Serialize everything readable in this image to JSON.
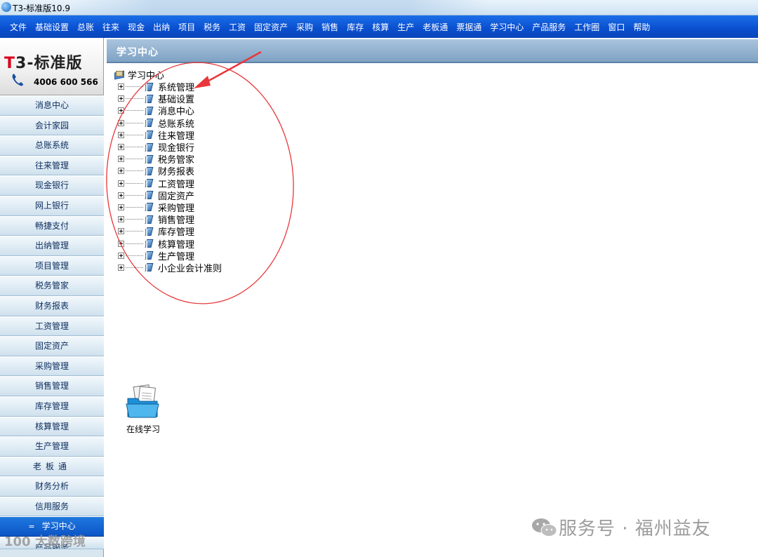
{
  "window": {
    "title": "T3-标准版10.9"
  },
  "menu": [
    "文件",
    "基础设置",
    "总账",
    "往来",
    "现金",
    "出纳",
    "项目",
    "税务",
    "工资",
    "固定资产",
    "采购",
    "销售",
    "库存",
    "核算",
    "生产",
    "老板通",
    "票据通",
    "学习中心",
    "产品服务",
    "工作圈",
    "窗口",
    "帮助"
  ],
  "logo": {
    "brand": "-标准版",
    "brand_letter_t": "T",
    "brand_num": "3",
    "phone": "4006 600 566"
  },
  "sidebar": {
    "items": [
      "消息中心",
      "会计家园",
      "总账系统",
      "往来管理",
      "现金银行",
      "网上银行",
      "畅捷支付",
      "出纳管理",
      "项目管理",
      "税务管家",
      "财务报表",
      "工资管理",
      "固定资产",
      "采购管理",
      "销售管理",
      "库存管理",
      "核算管理",
      "生产管理",
      "老板通",
      "财务分析",
      "信用服务",
      "学习中心",
      "产品服务"
    ],
    "active": "学习中心"
  },
  "main": {
    "header_title": "学习中心",
    "tree_root": "学习中心",
    "tree_nodes": [
      "系统管理",
      "基础设置",
      "消息中心",
      "总账系统",
      "往来管理",
      "现金银行",
      "税务管家",
      "财务报表",
      "工资管理",
      "固定资产",
      "采购管理",
      "销售管理",
      "库存管理",
      "核算管理",
      "生产管理",
      "小企业会计准则"
    ],
    "shortcut_label": "在线学习"
  },
  "watermarks": {
    "right": "服务号 · 福州益友",
    "left": "100 大数跨境"
  },
  "colors": {
    "menubar": "#0a4fcf",
    "annotation": "#e8373a"
  }
}
